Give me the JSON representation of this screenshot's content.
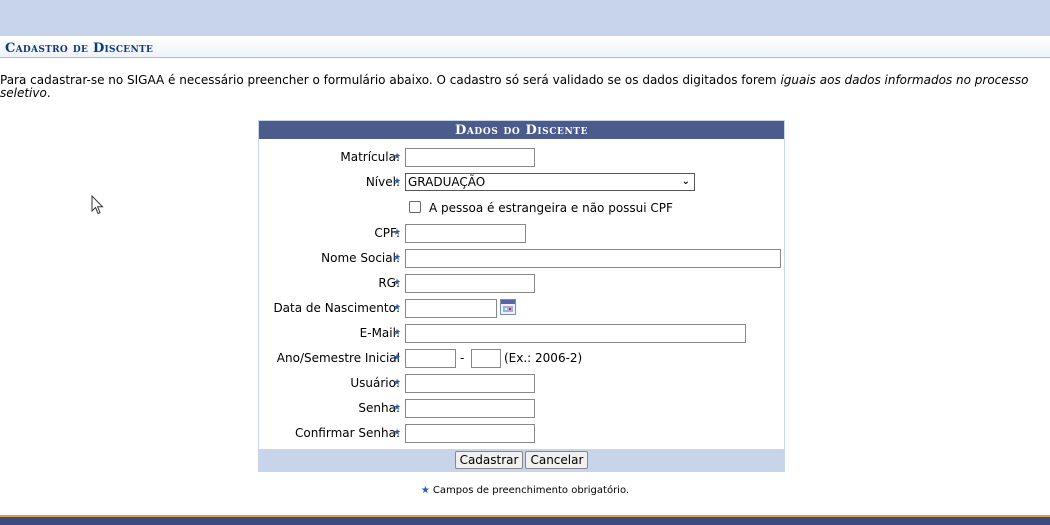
{
  "page": {
    "title": "Cadastro de Discente",
    "intro_text": "Para cadastrar-se no SIGAA é necessário preencher o formulário abaixo. O cadastro só será validado se os dados digitados forem ",
    "intro_emphasis": "iguais aos dados informados no processo seletivo",
    "intro_end": "."
  },
  "form": {
    "caption": "Dados do Discente",
    "required_mark": "★",
    "fields": {
      "matricula": {
        "label": "Matrícula:",
        "value": ""
      },
      "nivel": {
        "label": "Nível:",
        "selected": "GRADUAÇÃO"
      },
      "estrangeira": {
        "label": "A pessoa é estrangeira e não possui CPF",
        "checked": false
      },
      "cpf": {
        "label": "CPF:",
        "value": ""
      },
      "nome_social": {
        "label": "Nome Social:",
        "value": ""
      },
      "rg": {
        "label": "RG:",
        "value": ""
      },
      "data_nascimento": {
        "label": "Data de Nascimento:",
        "value": ""
      },
      "email": {
        "label": "E-Mail:",
        "value": ""
      },
      "ano_semestre": {
        "label": "Ano/Semestre Inicial",
        "separator": "-",
        "hint": "(Ex.: 2006-2)",
        "ano": "",
        "semestre": ""
      },
      "usuario": {
        "label": "Usuário:",
        "value": ""
      },
      "senha": {
        "label": "Senha:",
        "value": ""
      },
      "confirmar_senha": {
        "label": "Confirmar Senha:",
        "value": ""
      }
    },
    "buttons": {
      "submit": "Cadastrar",
      "cancel": "Cancelar"
    }
  },
  "footnote": {
    "star": "★",
    "text": "Campos de preenchimento obrigatório."
  },
  "icons": {
    "required": "star-icon",
    "calendar": "calendar-icon",
    "dropdown": "chevron-down-icon",
    "cursor": "mouse-pointer-icon"
  },
  "colors": {
    "header_band": "#c8d4ea",
    "caption_bg": "#4a5b8c",
    "title_text": "#0d3a7a",
    "star": "#2b5bb8",
    "bottom_bar": "#3e4a7e",
    "bottom_accent": "#d2a44f"
  }
}
